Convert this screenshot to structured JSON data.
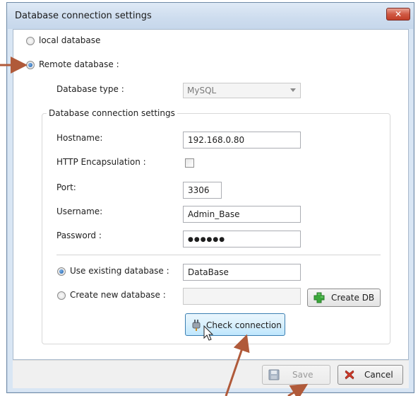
{
  "dialog": {
    "title": "Database connection settings",
    "close_glyph": "✕"
  },
  "db_mode": {
    "local_label": "local database",
    "remote_label": "Remote database :",
    "selected": "remote"
  },
  "database_type": {
    "label": "Database type :",
    "value": "MySQL",
    "enabled": false
  },
  "connection_group": {
    "legend": "Database connection settings",
    "hostname_label": "Hostname:",
    "hostname_value": "192.168.0.80",
    "http_label": "HTTP Encapsulation :",
    "http_checked": false,
    "port_label": "Port:",
    "port_value": "3306",
    "username_label": "Username:",
    "username_value": "Admin_Base",
    "password_label": "Password :",
    "password_value": "●●●●●●",
    "use_existing_label": "Use existing database :",
    "use_existing_value": "DataBase",
    "create_new_label": "Create new database :",
    "create_new_value": "",
    "selected_option": "use_existing",
    "create_db_button": "Create DB",
    "check_button": "Check connection"
  },
  "footer": {
    "save_label": "Save",
    "save_enabled": false,
    "cancel_label": "Cancel"
  },
  "icons": {
    "plus": "plus-icon",
    "plug": "plug-icon",
    "save": "floppy-disk-icon",
    "cancel": "red-x-icon",
    "cursor": "mouse-pointer-icon"
  },
  "colors": {
    "title_bar": "#cddcee",
    "close_button": "#c13e28",
    "annotation_arrow": "#b05a3a",
    "check_button": "#d9f0fc",
    "plus_green": "#3aa83a"
  }
}
